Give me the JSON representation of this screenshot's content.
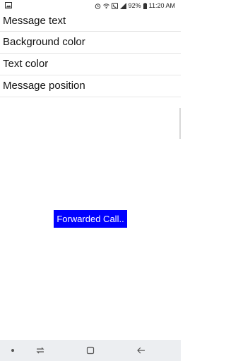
{
  "status_bar": {
    "left_icon": "image-icon",
    "icons": [
      "alarm-icon",
      "wifi-icon",
      "call-forward-icon",
      "cellular-signal-icon",
      "battery-icon"
    ],
    "battery_percent": "92%",
    "time": "11:20 AM"
  },
  "settings": {
    "items": [
      {
        "label": "Message text"
      },
      {
        "label": "Background color"
      },
      {
        "label": "Text color"
      },
      {
        "label": "Message position"
      }
    ]
  },
  "preview": {
    "message": "Forwarded Call..",
    "background_color": "#0000ff",
    "text_color": "#ffffff"
  },
  "nav_bar": {
    "buttons": [
      "dot-icon",
      "recent-apps-icon",
      "home-icon",
      "back-icon"
    ]
  }
}
